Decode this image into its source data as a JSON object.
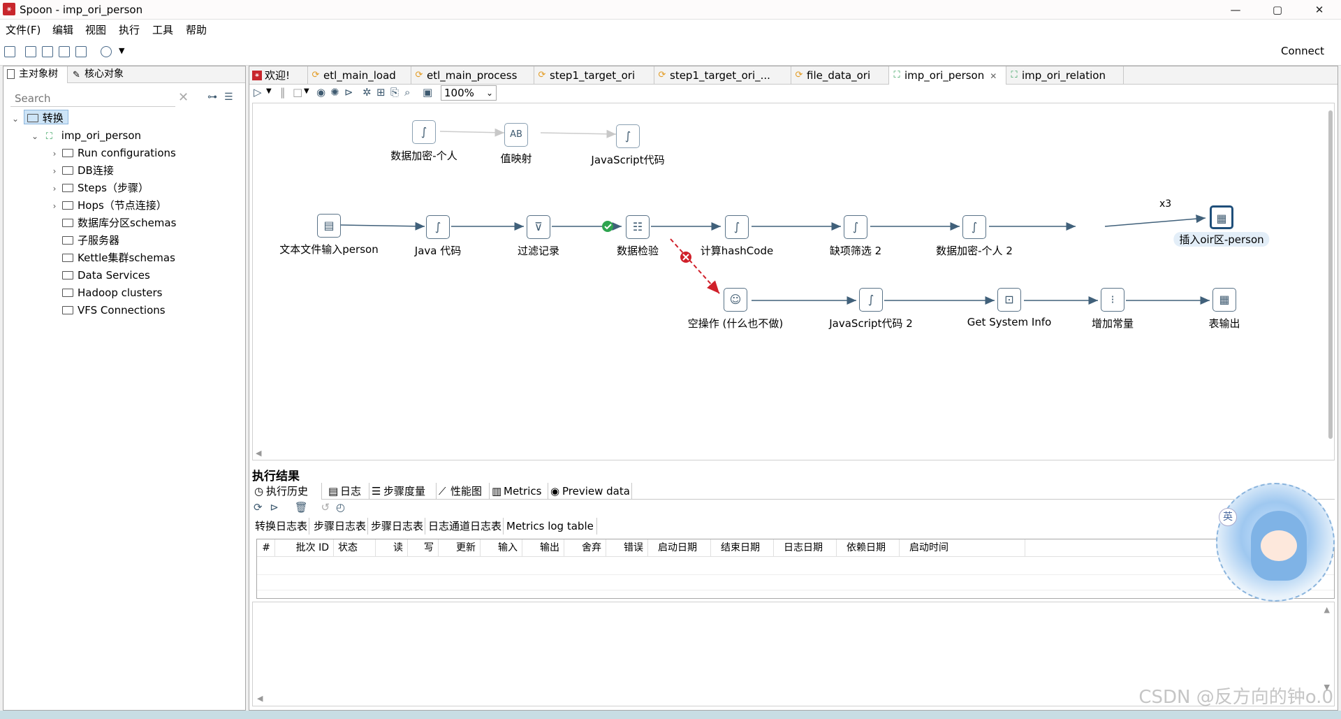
{
  "window": {
    "title": "Spoon - imp_ori_person",
    "app_icon": "spoon-logo",
    "controls": [
      "—",
      "▢",
      "✕"
    ]
  },
  "menu": [
    "文件(F)",
    "编辑",
    "视图",
    "执行",
    "工具",
    "帮助"
  ],
  "toolbar": {
    "connect_label": "Connect"
  },
  "left_panel": {
    "tabs": [
      {
        "label": "主对象树",
        "active": true
      },
      {
        "label": "核心对象",
        "active": false
      }
    ],
    "search_placeholder": "Search",
    "tree": {
      "root": "转换",
      "transformation": "imp_ori_person",
      "children": [
        {
          "label": "Run configurations",
          "expandable": true
        },
        {
          "label": "DB连接",
          "expandable": true
        },
        {
          "label": "Steps（步骤）",
          "expandable": true
        },
        {
          "label": "Hops（节点连接）",
          "expandable": true
        },
        {
          "label": "数据库分区schemas",
          "expandable": false
        },
        {
          "label": "子服务器",
          "expandable": false
        },
        {
          "label": "Kettle集群schemas",
          "expandable": false
        },
        {
          "label": "Data Services",
          "expandable": false
        },
        {
          "label": "Hadoop clusters",
          "expandable": false
        },
        {
          "label": "VFS Connections",
          "expandable": false
        }
      ]
    }
  },
  "editor": {
    "tabs": [
      {
        "label": "欢迎!",
        "icon": "spoon-logo",
        "active": false
      },
      {
        "label": "etl_main_load",
        "icon": "job-icon",
        "active": false
      },
      {
        "label": "etl_main_process",
        "icon": "job-icon",
        "active": false
      },
      {
        "label": "step1_target_ori",
        "icon": "job-icon",
        "active": false
      },
      {
        "label": "step1_target_ori_...",
        "icon": "job-icon",
        "active": false
      },
      {
        "label": "file_data_ori",
        "icon": "job-icon",
        "active": false
      },
      {
        "label": "imp_ori_person",
        "icon": "transformation-icon",
        "active": true,
        "closable": true
      },
      {
        "label": "imp_ori_relation",
        "icon": "transformation-icon",
        "active": false
      }
    ],
    "zoom": "100%",
    "steps": [
      {
        "id": "s1",
        "label": "数据加密-个人",
        "icon": "script-icon",
        "disabled": true
      },
      {
        "id": "s2",
        "label": "值映射",
        "icon": "value-mapper-icon",
        "disabled": true
      },
      {
        "id": "s3",
        "label": "JavaScript代码",
        "icon": "javascript-icon",
        "disabled": true
      },
      {
        "id": "m1",
        "label": "文本文件输入person",
        "icon": "text-file-input-icon"
      },
      {
        "id": "m2",
        "label": "Java 代码",
        "icon": "script-icon"
      },
      {
        "id": "m3",
        "label": "过滤记录",
        "icon": "filter-icon"
      },
      {
        "id": "m4",
        "label": "数据检验",
        "icon": "validator-icon"
      },
      {
        "id": "m5",
        "label": "计算hashCode",
        "icon": "script-icon"
      },
      {
        "id": "m6",
        "label": "缺项筛选 2",
        "icon": "script-icon"
      },
      {
        "id": "m7",
        "label": "数据加密-个人 2",
        "icon": "script-icon"
      },
      {
        "id": "m8",
        "label": "插入oir区-person",
        "icon": "table-output-icon",
        "badge": "x3",
        "selected": true
      },
      {
        "id": "e1",
        "label": "空操作 (什么也不做)",
        "icon": "dummy-icon"
      },
      {
        "id": "e2",
        "label": "JavaScript代码 2",
        "icon": "javascript-icon"
      },
      {
        "id": "e3",
        "label": "Get System Info",
        "icon": "system-info-icon"
      },
      {
        "id": "e4",
        "label": "增加常量",
        "icon": "constant-icon"
      },
      {
        "id": "e5",
        "label": "表输出",
        "icon": "table-output-icon"
      }
    ]
  },
  "results": {
    "title": "执行结果",
    "tabs": [
      {
        "label": "执行历史",
        "active": true
      },
      {
        "label": "日志",
        "active": false
      },
      {
        "label": "步骤度量",
        "active": false
      },
      {
        "label": "性能图",
        "active": false
      },
      {
        "label": "Metrics",
        "active": false
      },
      {
        "label": "Preview data",
        "active": false
      }
    ],
    "log_tabs": [
      {
        "label": "转换日志表",
        "active": true
      },
      {
        "label": "步骤日志表",
        "active": false
      },
      {
        "label": "步骤日志表",
        "active": false
      },
      {
        "label": "日志通道日志表",
        "active": false
      },
      {
        "label": "Metrics log table",
        "active": false
      }
    ],
    "columns": [
      "#",
      "批次 ID",
      "状态",
      "读",
      "写",
      "更新",
      "输入",
      "输出",
      "舍弃",
      "错误",
      "启动日期",
      "结束日期",
      "日志日期",
      "依赖日期",
      "启动时间"
    ]
  },
  "watermark": "CSDN @反方向的钟o.0",
  "mascot_badges": [
    "英"
  ]
}
